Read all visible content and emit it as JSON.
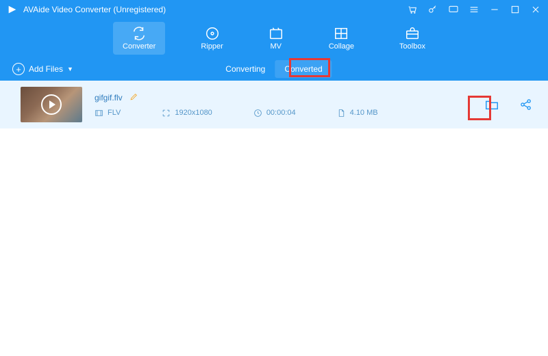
{
  "titlebar": {
    "title": "AVAide Video Converter (Unregistered)"
  },
  "nav": {
    "items": [
      {
        "label": "Converter"
      },
      {
        "label": "Ripper"
      },
      {
        "label": "MV"
      },
      {
        "label": "Collage"
      },
      {
        "label": "Toolbox"
      }
    ]
  },
  "subbar": {
    "add_files_label": "Add Files",
    "tabs": {
      "converting": "Converting",
      "converted": "Converted"
    }
  },
  "file": {
    "name": "gifgif.flv",
    "format": "FLV",
    "resolution": "1920x1080",
    "duration": "00:00:04",
    "size": "4.10 MB"
  }
}
